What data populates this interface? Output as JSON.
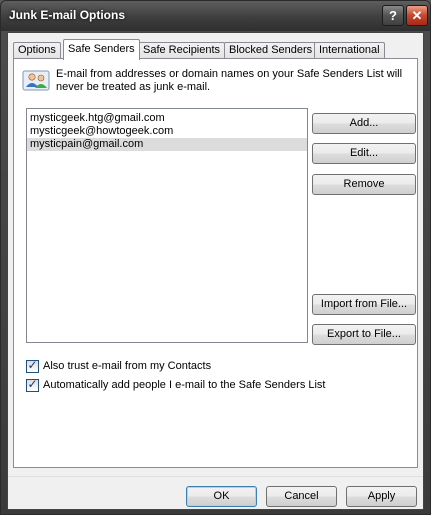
{
  "window": {
    "title": "Junk E-mail Options"
  },
  "title_buttons": {
    "help_label": "?",
    "close_label": "✕"
  },
  "tabs": [
    {
      "label": "Options",
      "active": false
    },
    {
      "label": "Safe Senders",
      "active": true
    },
    {
      "label": "Safe Recipients",
      "active": false
    },
    {
      "label": "Blocked Senders",
      "active": false
    },
    {
      "label": "International",
      "active": false
    }
  ],
  "panel": {
    "icon": "safe-senders-people-icon",
    "description": "E-mail from addresses or domain names on your Safe Senders List will never be treated as junk e-mail.",
    "list_items": [
      "mysticgeek.htg@gmail.com",
      "mysticgeek@howtogeek.com",
      "mysticpain@gmail.com"
    ],
    "selected_index": 2,
    "buttons": {
      "add": "Add...",
      "edit": "Edit...",
      "remove": "Remove",
      "import": "Import from File...",
      "export": "Export to File..."
    },
    "checkboxes": {
      "trust_contacts": {
        "label": "Also trust e-mail from my Contacts",
        "checked": true
      },
      "auto_add": {
        "label": "Automatically add people I e-mail to the Safe Senders List",
        "checked": true
      }
    }
  },
  "footer": {
    "ok": "OK",
    "cancel": "Cancel",
    "apply": "Apply"
  }
}
